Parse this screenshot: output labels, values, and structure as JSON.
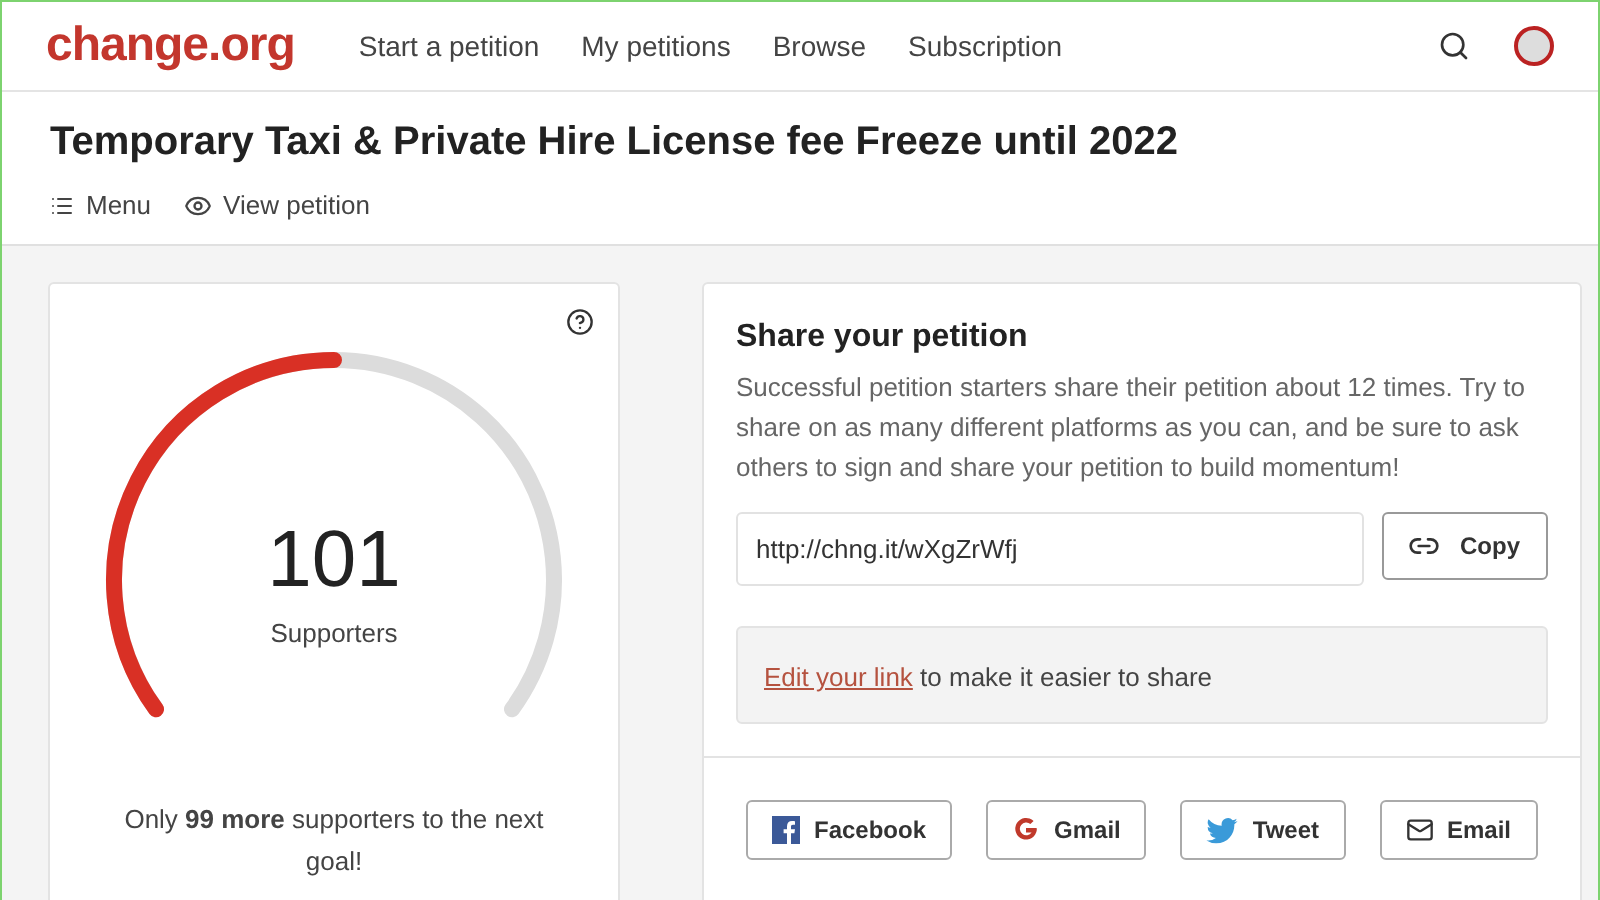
{
  "header": {
    "logo": "change.org",
    "nav": [
      {
        "label": "Start a petition"
      },
      {
        "label": "My petitions"
      },
      {
        "label": "Browse"
      },
      {
        "label": "Subscription"
      }
    ]
  },
  "petition": {
    "title": "Temporary Taxi & Private Hire License fee Freeze until 2022",
    "actions": [
      {
        "kind": "menu",
        "label": "Menu"
      },
      {
        "kind": "view",
        "label": "View petition"
      }
    ]
  },
  "progress": {
    "count": "101",
    "caption": "Supporters",
    "level": 0.5,
    "message": "Only **99 more** supporters to the next goal!"
  },
  "share": {
    "title": "Share your petition",
    "description": "Successful petition starters share their petition about 12 times. Try to share on as many different platforms as you can, and be sure to ask others to sign and share your petition to build momentum!",
    "link": "http://chng.it/wXgZrWfj",
    "copy_label": "Copy",
    "edit_link": "Edit your link",
    "edit_text": "to make it easier to share",
    "buttons": [
      {
        "kind": "facebook",
        "label": "Facebook"
      },
      {
        "kind": "gmail",
        "label": "Gmail"
      },
      {
        "kind": "twitter",
        "label": "Tweet"
      },
      {
        "kind": "email",
        "label": "Email"
      }
    ]
  }
}
